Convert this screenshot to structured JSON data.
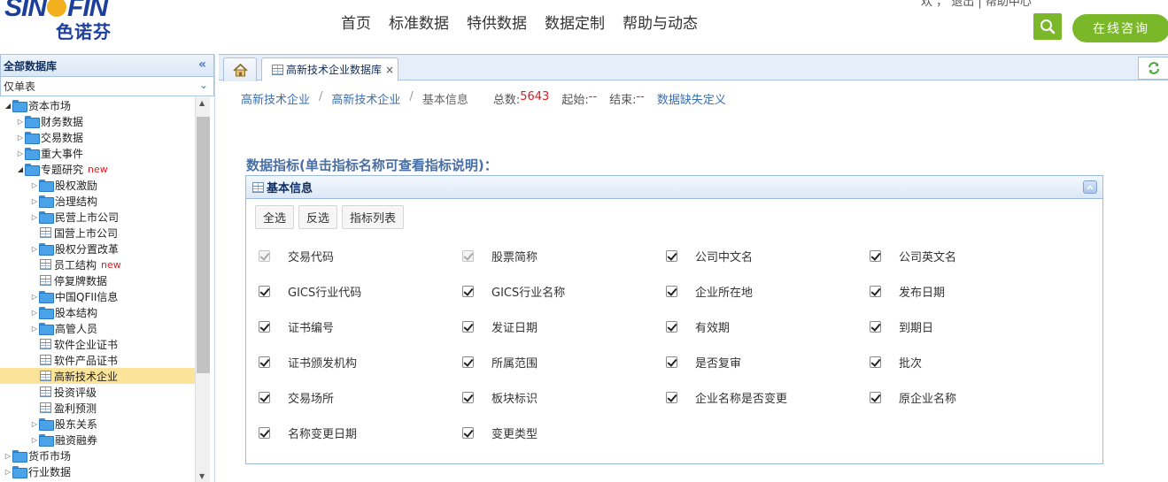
{
  "header": {
    "brand_text_left": "SIN",
    "brand_text_right": "FIN",
    "brand_cn": "色诺芬",
    "nav": [
      "首页",
      "标准数据",
      "特供数据",
      "数据定制",
      "帮助与动态"
    ],
    "top_cut_text": "欢     ，    退出  |  帮助中心",
    "search_icon": "search-icon",
    "consult_label": "在线咨询"
  },
  "sidebar": {
    "title": "全部数据库",
    "select_value": "仅单表",
    "tree": [
      {
        "label": "资本市场",
        "level": 0,
        "type": "folder",
        "expanded": true
      },
      {
        "label": "财务数据",
        "level": 1,
        "type": "folder",
        "expanded": false
      },
      {
        "label": "交易数据",
        "level": 1,
        "type": "folder",
        "expanded": false
      },
      {
        "label": "重大事件",
        "level": 1,
        "type": "folder",
        "expanded": false
      },
      {
        "label": "专题研究",
        "level": 1,
        "type": "folder",
        "expanded": true,
        "badge": "new"
      },
      {
        "label": "股权激励",
        "level": 2,
        "type": "folder",
        "expanded": false
      },
      {
        "label": "治理结构",
        "level": 2,
        "type": "folder",
        "expanded": false
      },
      {
        "label": "民营上市公司",
        "level": 2,
        "type": "folder",
        "expanded": false
      },
      {
        "label": "国营上市公司",
        "level": 2,
        "type": "table"
      },
      {
        "label": "股权分置改革",
        "level": 2,
        "type": "folder",
        "expanded": false
      },
      {
        "label": "员工结构",
        "level": 2,
        "type": "table",
        "badge": "new"
      },
      {
        "label": "停复牌数据",
        "level": 2,
        "type": "table"
      },
      {
        "label": "中国QFII信息",
        "level": 2,
        "type": "folder",
        "expanded": false
      },
      {
        "label": "股本结构",
        "level": 2,
        "type": "folder",
        "expanded": false
      },
      {
        "label": "高管人员",
        "level": 2,
        "type": "folder",
        "expanded": false
      },
      {
        "label": "软件企业证书",
        "level": 2,
        "type": "table"
      },
      {
        "label": "软件产品证书",
        "level": 2,
        "type": "table"
      },
      {
        "label": "高新技术企业",
        "level": 2,
        "type": "table",
        "selected": true
      },
      {
        "label": "投资评级",
        "level": 2,
        "type": "table"
      },
      {
        "label": "盈利预测",
        "level": 2,
        "type": "table"
      },
      {
        "label": "股东关系",
        "level": 2,
        "type": "folder",
        "expanded": false
      },
      {
        "label": "融资融券",
        "level": 2,
        "type": "folder",
        "expanded": false
      },
      {
        "label": "货币市场",
        "level": 0,
        "type": "folder",
        "expanded": false
      },
      {
        "label": "行业数据",
        "level": 0,
        "type": "folder",
        "expanded": false
      }
    ]
  },
  "tabs": {
    "home_icon": "home-icon",
    "active_label": "高新技术企业数据库",
    "close_glyph": "×",
    "refresh_icon": "refresh-icon"
  },
  "breadcrumb": {
    "level1": "高新技术企业",
    "level2": "高新技术企业",
    "current": "基本信息",
    "separator": "/",
    "total_label": "总数:",
    "total_value": "5643",
    "start_label": "起始:",
    "start_value": "--",
    "end_label": "结束:",
    "end_value": "--",
    "missing_link": "数据缺失定义"
  },
  "section": {
    "title": "数据指标(单击指标名称可查看指标说明)："
  },
  "panel": {
    "title": "基本信息",
    "buttons": [
      "全选",
      "反选",
      "指标列表"
    ],
    "fields": [
      {
        "label": "交易代码",
        "checked": true,
        "disabled": true
      },
      {
        "label": "股票简称",
        "checked": true,
        "disabled": true
      },
      {
        "label": "公司中文名",
        "checked": true,
        "disabled": false
      },
      {
        "label": "公司英文名",
        "checked": true,
        "disabled": false
      },
      {
        "label": "GICS行业代码",
        "checked": true,
        "disabled": false
      },
      {
        "label": "GICS行业名称",
        "checked": true,
        "disabled": false
      },
      {
        "label": "企业所在地",
        "checked": true,
        "disabled": false
      },
      {
        "label": "发布日期",
        "checked": true,
        "disabled": false
      },
      {
        "label": "证书编号",
        "checked": true,
        "disabled": false
      },
      {
        "label": "发证日期",
        "checked": true,
        "disabled": false
      },
      {
        "label": "有效期",
        "checked": true,
        "disabled": false
      },
      {
        "label": "到期日",
        "checked": true,
        "disabled": false
      },
      {
        "label": "证书颁发机构",
        "checked": true,
        "disabled": false
      },
      {
        "label": "所属范围",
        "checked": true,
        "disabled": false
      },
      {
        "label": "是否复审",
        "checked": true,
        "disabled": false
      },
      {
        "label": "批次",
        "checked": true,
        "disabled": false
      },
      {
        "label": "交易场所",
        "checked": true,
        "disabled": false
      },
      {
        "label": "板块标识",
        "checked": true,
        "disabled": false
      },
      {
        "label": "企业名称是否变更",
        "checked": true,
        "disabled": false
      },
      {
        "label": "原企业名称",
        "checked": true,
        "disabled": false
      },
      {
        "label": "名称变更日期",
        "checked": true,
        "disabled": false
      },
      {
        "label": "变更类型",
        "checked": true,
        "disabled": false
      }
    ]
  },
  "colors": {
    "brand_blue": "#1b3f9a",
    "accent_green": "#7ab829",
    "link_blue": "#3a6fb0",
    "value_red": "#e4181e",
    "selected_row": "#fbe49a"
  }
}
